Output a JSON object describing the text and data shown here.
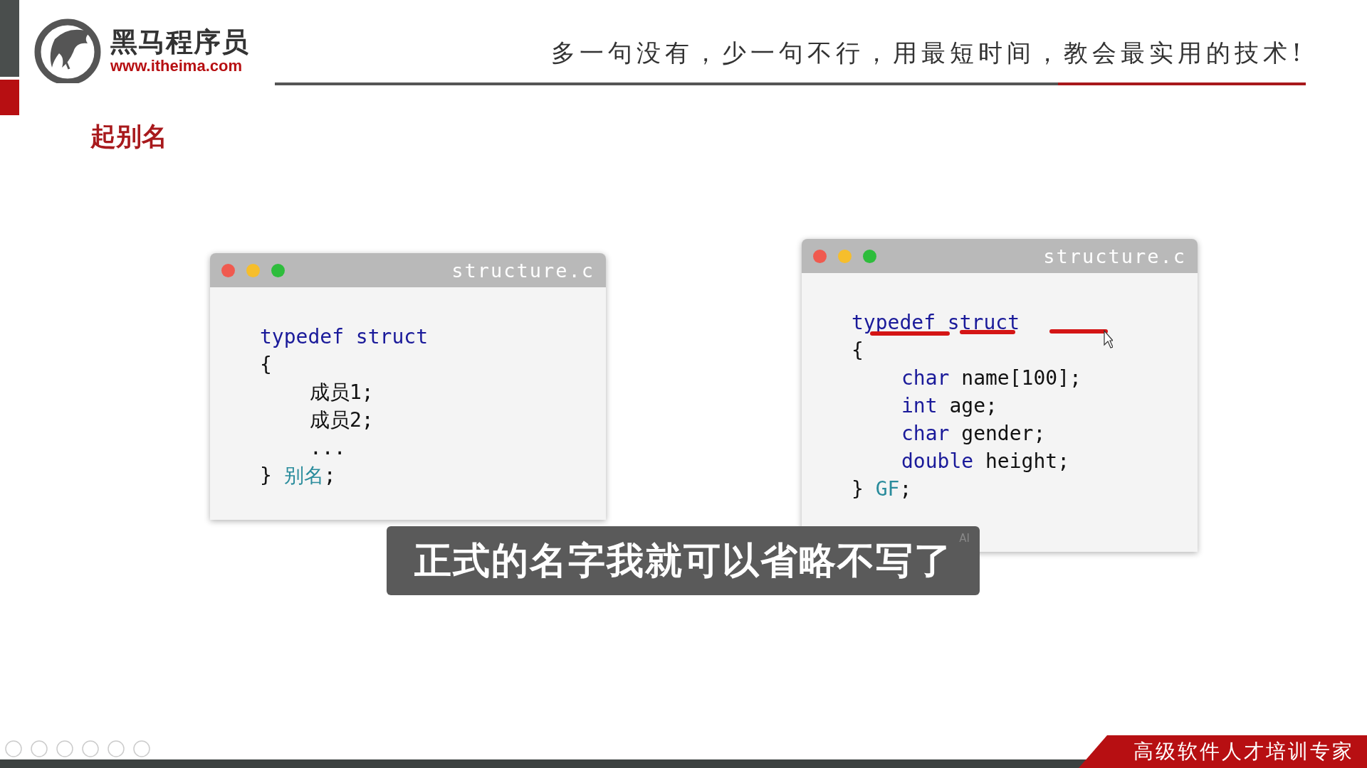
{
  "header": {
    "brand": "黑马程序员",
    "url": "www.itheima.com",
    "slogan": "多一句没有，少一句不行，用最短时间，教会最实用的技术!"
  },
  "slide_title": "起别名",
  "windows": [
    {
      "title": "structure.c",
      "annotated": false,
      "lines": [
        {
          "indented": false,
          "tokens": [
            {
              "text": "typedef struct",
              "kind": "keyword"
            }
          ]
        },
        {
          "indented": false,
          "tokens": [
            {
              "text": "{",
              "kind": "plain"
            }
          ]
        },
        {
          "indented": true,
          "tokens": [
            {
              "text": "成员1;",
              "kind": "plain"
            }
          ]
        },
        {
          "indented": true,
          "tokens": [
            {
              "text": "成员2;",
              "kind": "plain"
            }
          ]
        },
        {
          "indented": true,
          "tokens": [
            {
              "text": "...",
              "kind": "plain"
            }
          ]
        },
        {
          "indented": false,
          "tokens": [
            {
              "text": "} ",
              "kind": "plain"
            },
            {
              "text": "别名",
              "kind": "alias"
            },
            {
              "text": ";",
              "kind": "plain"
            }
          ]
        }
      ]
    },
    {
      "title": "structure.c",
      "annotated": true,
      "lines": [
        {
          "indented": false,
          "tokens": [
            {
              "text": "typedef struct",
              "kind": "keyword"
            }
          ]
        },
        {
          "indented": false,
          "tokens": [
            {
              "text": "{",
              "kind": "plain"
            }
          ]
        },
        {
          "indented": true,
          "tokens": [
            {
              "text": "char",
              "kind": "keyword"
            },
            {
              "text": " name[100];",
              "kind": "plain"
            }
          ]
        },
        {
          "indented": true,
          "tokens": [
            {
              "text": "int",
              "kind": "keyword"
            },
            {
              "text": " age;",
              "kind": "plain"
            }
          ]
        },
        {
          "indented": true,
          "tokens": [
            {
              "text": "char",
              "kind": "keyword"
            },
            {
              "text": " gender;",
              "kind": "plain"
            }
          ]
        },
        {
          "indented": true,
          "tokens": [
            {
              "text": "double",
              "kind": "keyword"
            },
            {
              "text": " height;",
              "kind": "plain"
            }
          ]
        },
        {
          "indented": false,
          "tokens": [
            {
              "text": "} ",
              "kind": "plain"
            },
            {
              "text": "GF",
              "kind": "alias"
            },
            {
              "text": ";",
              "kind": "plain"
            }
          ]
        }
      ]
    }
  ],
  "subtitle": {
    "text": "正式的名字我就可以省略不写了",
    "badge": "AI"
  },
  "footer": {
    "banner": "高级软件人才培训专家"
  }
}
